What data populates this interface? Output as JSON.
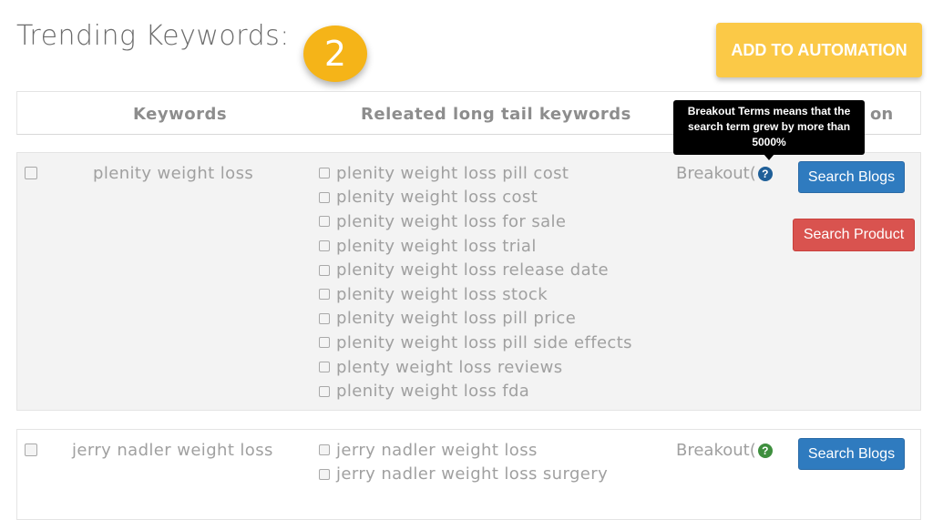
{
  "page": {
    "title": "Trending Keywords:",
    "step_number": "2",
    "add_button_label": "ADD TO AUTOMATION"
  },
  "table": {
    "columns": [
      "Keywords",
      "Releated long tail keywords",
      "on"
    ],
    "tooltip": {
      "line1": "Breakout Terms means that the",
      "line2": "search term grew by more than",
      "line3": "5000%"
    },
    "rows": [
      {
        "keyword": "plenity weight loss",
        "long_tail": [
          "plenity weight loss pill cost",
          "plenity weight loss cost",
          "plenity weight loss for sale",
          "plenity weight loss trial",
          "plenity weight loss release date",
          "plenity weight loss stock",
          "plenity weight loss pill price",
          "plenity weight loss pill side effects",
          "plenty weight loss reviews",
          "plenity weight loss fda"
        ],
        "volume": "Breakout(",
        "help_icon": "question-circle-icon",
        "help_color": "#1f5f98",
        "search_blogs_label": "Search Blogs",
        "search_product_label": "Search Product"
      },
      {
        "keyword": "jerry nadler weight loss",
        "long_tail": [
          "jerry nadler weight loss",
          "jerry nadler weight loss surgery"
        ],
        "volume": "Breakout(",
        "help_icon": "question-circle-icon",
        "help_color": "#3e8f3e",
        "search_blogs_label": "Search Blogs"
      }
    ]
  },
  "colors": {
    "badge": "#f5b418",
    "add_button": "#fbc947",
    "search_blogs": "#2f7bbf",
    "search_product": "#d9534f"
  }
}
